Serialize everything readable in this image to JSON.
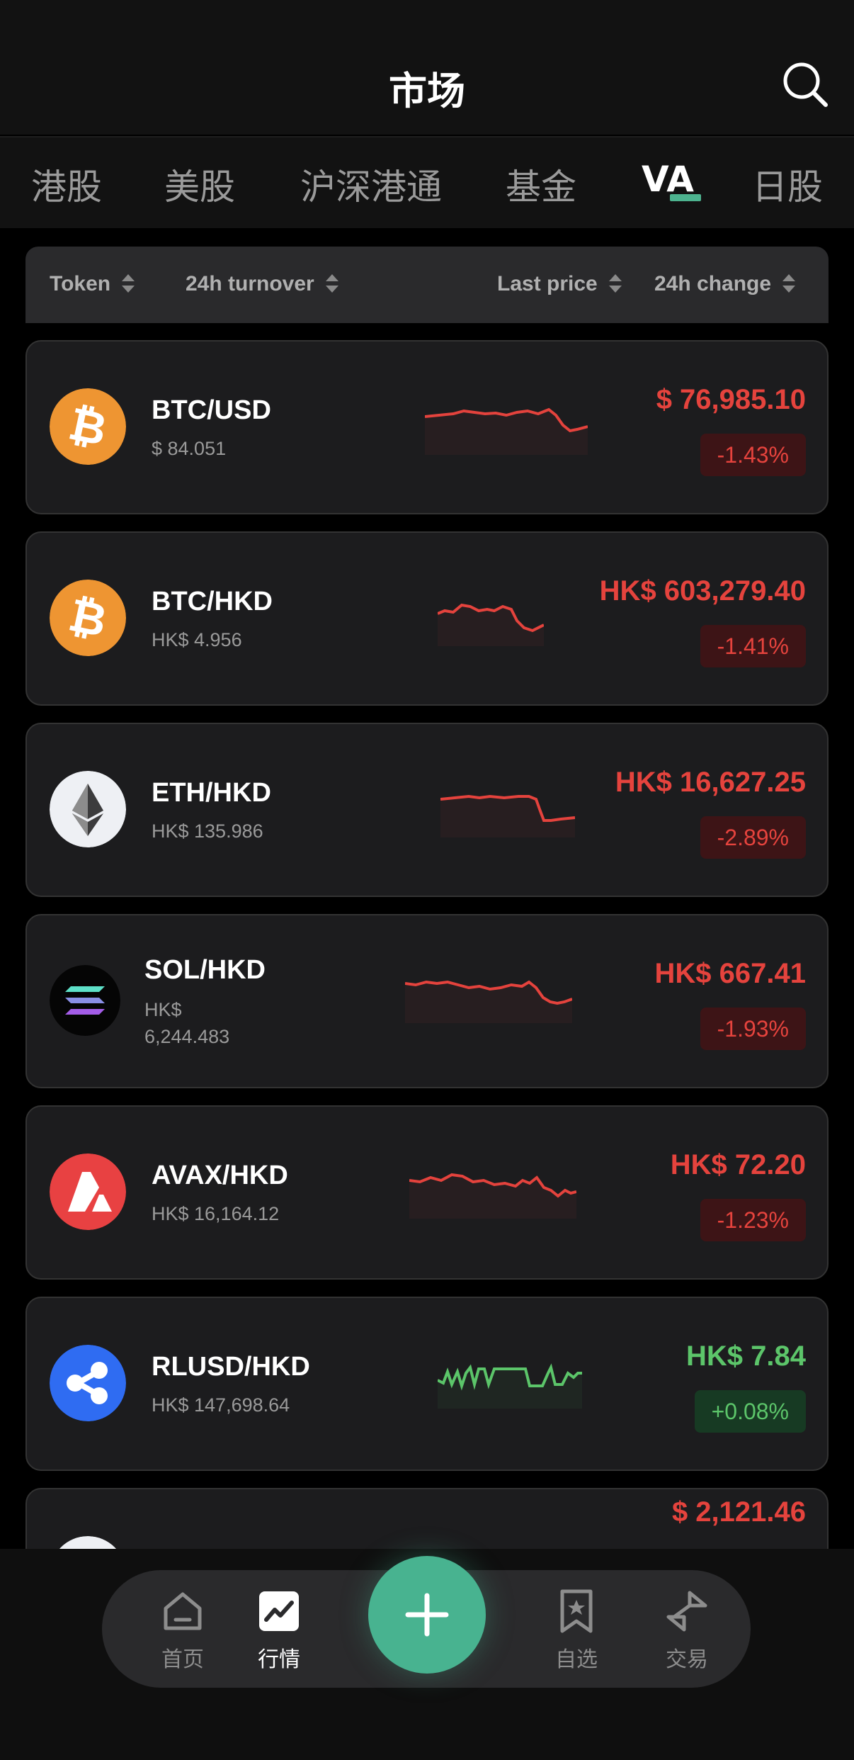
{
  "header": {
    "title": "市场"
  },
  "tabs": [
    {
      "label": "港股"
    },
    {
      "label": "美股"
    },
    {
      "label": "沪深港通"
    },
    {
      "label": "基金"
    },
    {
      "label": "VA"
    },
    {
      "label": "日股"
    }
  ],
  "active_tab": "VA",
  "columns": {
    "token": "Token",
    "turnover": "24h turnover",
    "last_price": "Last price",
    "change": "24h change"
  },
  "rows": [
    {
      "pair": "BTC/USD",
      "turnover": "$ 84.051",
      "price": "$ 76,985.10",
      "change": "-1.43%",
      "trend": "down",
      "icon": "bitcoin-icon"
    },
    {
      "pair": "BTC/HKD",
      "turnover": "HK$ 4.956",
      "price": "HK$ 603,279.40",
      "change": "-1.41%",
      "trend": "down",
      "icon": "bitcoin-icon"
    },
    {
      "pair": "ETH/HKD",
      "turnover": "HK$ 135.986",
      "price": "HK$ 16,627.25",
      "change": "-2.89%",
      "trend": "down",
      "icon": "ethereum-icon"
    },
    {
      "pair": "SOL/HKD",
      "turnover_line1": "HK$",
      "turnover_line2": "6,244.483",
      "price": "HK$ 667.41",
      "change": "-1.93%",
      "trend": "down",
      "icon": "solana-icon"
    },
    {
      "pair": "AVAX/HKD",
      "turnover": "HK$ 16,164.12",
      "price": "HK$ 72.20",
      "change": "-1.23%",
      "trend": "down",
      "icon": "avalanche-icon"
    },
    {
      "pair": "RLUSD/HKD",
      "turnover": "HK$ 147,698.64",
      "price": "HK$ 7.84",
      "change": "+0.08%",
      "trend": "up",
      "icon": "ripple-icon"
    }
  ],
  "partial_row": {
    "price": "$ 2,121.46"
  },
  "nav": {
    "home": "首页",
    "market": "行情",
    "watchlist": "自选",
    "trade": "交易"
  },
  "colors": {
    "accent": "#48b390",
    "down": "#e5433d",
    "up": "#5cc56a",
    "background": "#000000",
    "card": "#1c1c1e"
  }
}
